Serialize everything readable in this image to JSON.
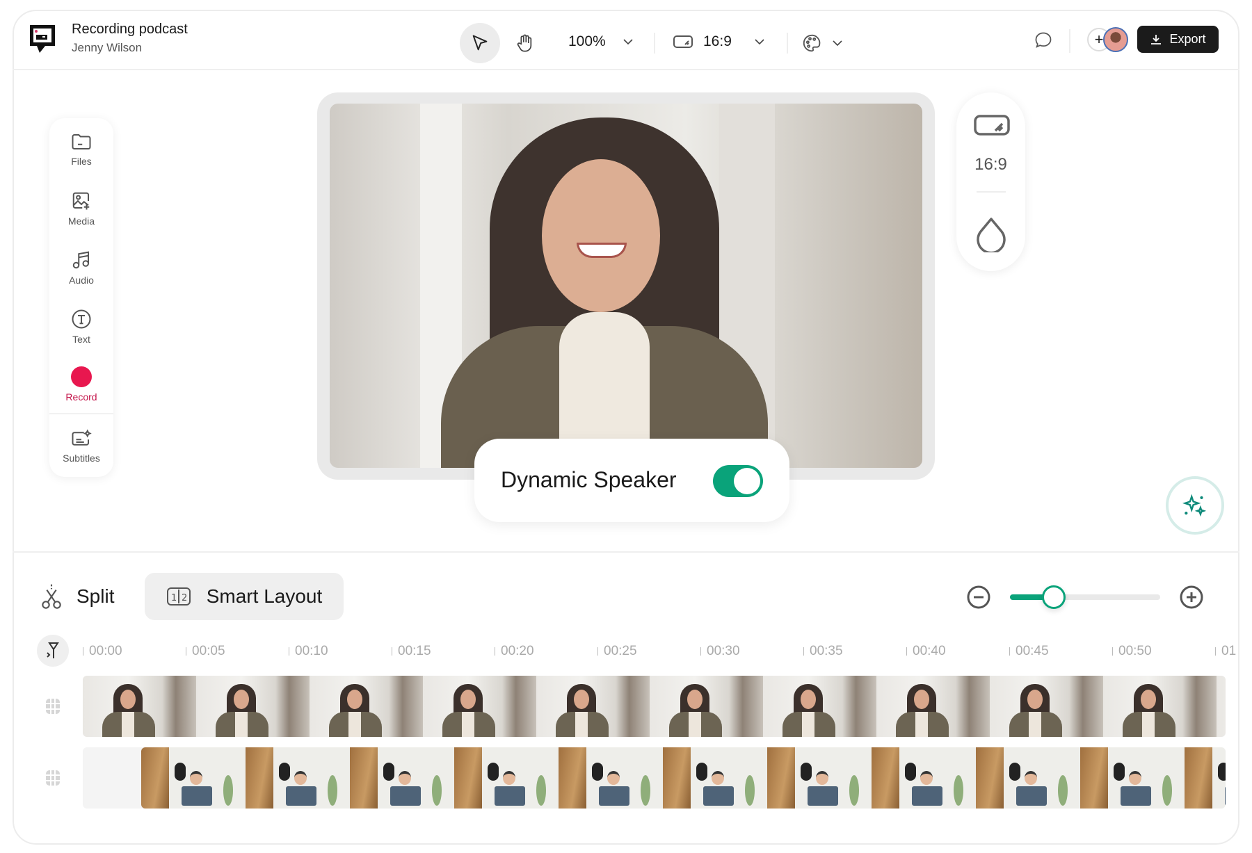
{
  "header": {
    "project_title": "Recording podcast",
    "owner": "Jenny Wilson",
    "zoom": "100%",
    "aspect_ratio": "16:9",
    "export_label": "Export"
  },
  "sidebar": {
    "items": [
      {
        "label": "Files",
        "icon": "folder-icon"
      },
      {
        "label": "Media",
        "icon": "image-add-icon"
      },
      {
        "label": "Audio",
        "icon": "music-icon"
      },
      {
        "label": "Text",
        "icon": "text-icon"
      },
      {
        "label": "Record",
        "icon": "record-icon"
      },
      {
        "label": "Subtitles",
        "icon": "subtitles-icon"
      }
    ]
  },
  "preview": {
    "dynamic_speaker_label": "Dynamic Speaker",
    "dynamic_speaker_on": true
  },
  "right_panel": {
    "aspect_ratio": "16:9"
  },
  "timeline": {
    "split_label": "Split",
    "smart_layout_label": "Smart Layout",
    "zoom_level": 0.29,
    "ticks": [
      "00:00",
      "00:05",
      "00:10",
      "00:15",
      "00:20",
      "00:25",
      "00:30",
      "00:35",
      "00:40",
      "00:45",
      "00:50",
      "01"
    ]
  },
  "colors": {
    "accent": "#0aa37a",
    "record": "#e8174f",
    "export_bg": "#1b1b1b"
  }
}
